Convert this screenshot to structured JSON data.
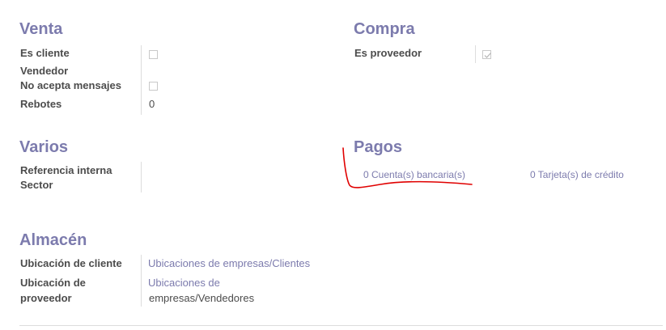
{
  "venta": {
    "title": "Venta",
    "es_cliente_label": "Es cliente",
    "vendedor_label": "Vendedor",
    "no_acepta_label": "No acepta mensajes",
    "rebotes_label": "Rebotes",
    "rebotes_value": "0"
  },
  "compra": {
    "title": "Compra",
    "es_proveedor_label": "Es proveedor"
  },
  "varios": {
    "title": "Varios",
    "referencia_label": "Referencia interna",
    "sector_label": "Sector"
  },
  "pagos": {
    "title": "Pagos",
    "cuentas_link": "0 Cuenta(s) bancaria(s)",
    "tarjetas_link": "0 Tarjeta(s) de crédito"
  },
  "almacen": {
    "title": "Almacén",
    "ubic_cliente_label": "Ubicación de cliente",
    "ubic_cliente_value": "Ubicaciones de empresas/Clientes",
    "ubic_proveedor_label_1": "Ubicación de",
    "ubic_proveedor_label_2": "proveedor",
    "ubic_proveedor_value_1": "Ubicaciones de",
    "ubic_proveedor_value_2": "empresas/Vendedores"
  },
  "colors": {
    "accent": "#7c7bad",
    "annotation": "#e00000"
  }
}
